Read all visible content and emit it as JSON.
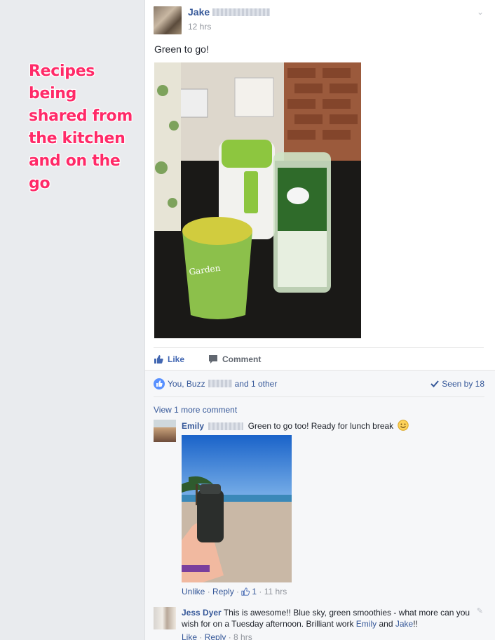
{
  "annotation": "Recipes being shared from the kitchen and on the go",
  "post": {
    "author": "Jake",
    "time": "12 hrs",
    "text": "Green to go!",
    "photo_text": "Garden",
    "actions": {
      "like": "Like",
      "comment": "Comment"
    }
  },
  "reactions": {
    "likers": "You, Buzz",
    "others": "and 1 other",
    "seen": "Seen by 18"
  },
  "comments": {
    "view_more": "View 1 more comment",
    "items": [
      {
        "author": "Emily",
        "text": "Green to go too! Ready for lunch break",
        "meta": {
          "unlike": "Unlike",
          "reply": "Reply",
          "like_count": "1",
          "time": "11 hrs"
        }
      },
      {
        "author": "Jess Dyer",
        "text_before": "This is awesome!! Blue sky, green smoothies - what more can you wish for on a Tuesday afternoon. Brilliant work ",
        "mention1": "Emily",
        "and": " and ",
        "mention2": "Jake",
        "text_after": "!!",
        "meta": {
          "like": "Like",
          "reply": "Reply",
          "time": "8 hrs"
        }
      }
    ]
  },
  "colors": {
    "link": "#365899",
    "annotation": "#ff2a68",
    "like_blue": "#4267b2",
    "background": "#e9ebee"
  }
}
